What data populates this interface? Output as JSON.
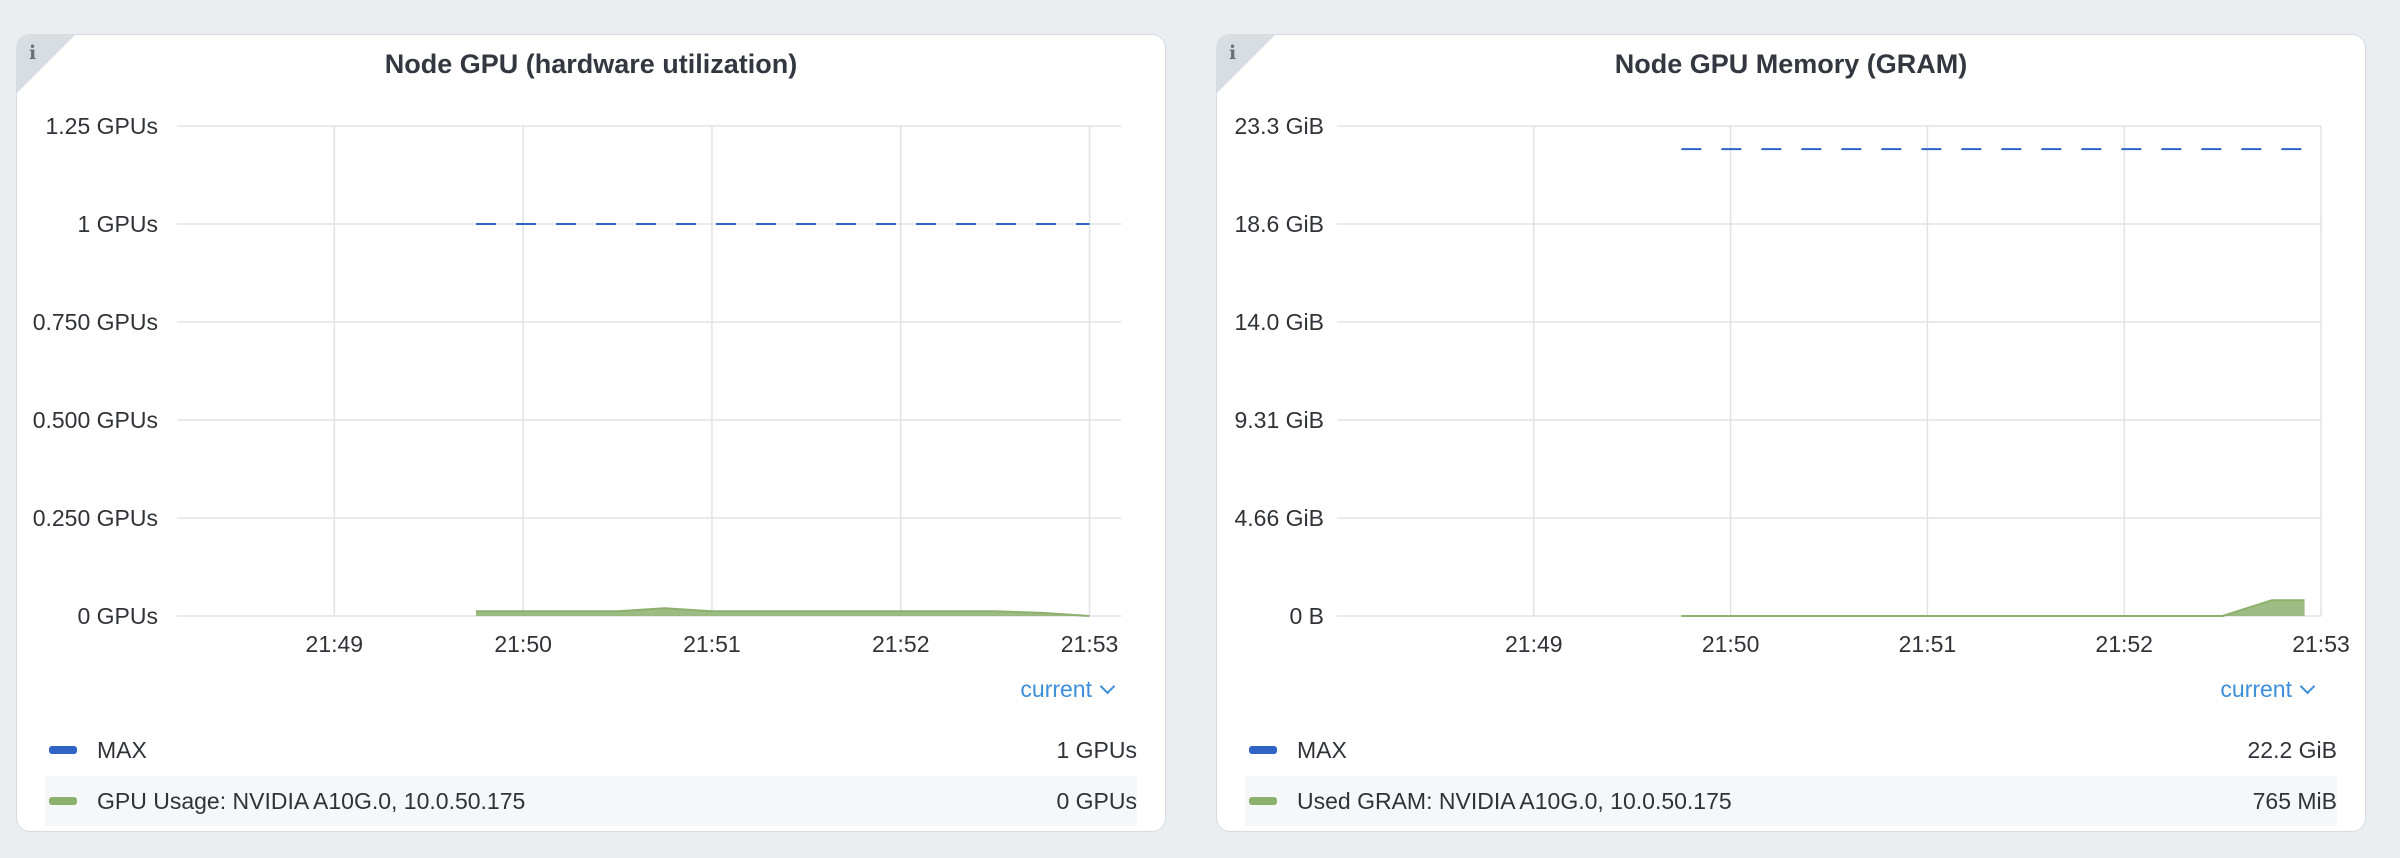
{
  "colors": {
    "max": "#2f63c6",
    "usage": "#8cb06d",
    "grid": "#e0e3e6",
    "link": "#3d8fd9"
  },
  "panels": [
    {
      "title": "Node GPU (hardware utilization)",
      "info_icon": "info-icon",
      "legend_toggle": "current",
      "legend": [
        {
          "name": "MAX",
          "value": "1 GPUs"
        },
        {
          "name": "GPU Usage: NVIDIA A10G.0, 10.0.50.175",
          "value": "0 GPUs"
        }
      ]
    },
    {
      "title": "Node GPU Memory (GRAM)",
      "info_icon": "info-icon",
      "legend_toggle": "current",
      "legend": [
        {
          "name": "MAX",
          "value": "22.2 GiB"
        },
        {
          "name": "Used GRAM: NVIDIA A10G.0, 10.0.50.175",
          "value": "765 MiB"
        }
      ]
    }
  ],
  "chart_data": [
    {
      "type": "area",
      "x_range": [
        "21:48:10",
        "21:53:10"
      ],
      "x_ticks": [
        "21:49",
        "21:50",
        "21:51",
        "21:52",
        "21:53"
      ],
      "y_ticks": [
        "0 GPUs",
        "0.250 GPUs",
        "0.500 GPUs",
        "0.750 GPUs",
        "1 GPUs",
        "1.25 GPUs"
      ],
      "ylim": [
        0,
        1.25
      ],
      "grid": true,
      "legend_position": "bottom",
      "series": [
        {
          "name": "MAX",
          "style": "dashed-line",
          "x": [
            "21:49:45",
            "21:53:00"
          ],
          "y": [
            1,
            1
          ]
        },
        {
          "name": "GPU Usage: NVIDIA A10G.0, 10.0.50.175",
          "style": "area",
          "x": [
            "21:49:45",
            "21:50:00",
            "21:50:30",
            "21:50:45",
            "21:51:00",
            "21:51:30",
            "21:52:00",
            "21:52:30",
            "21:52:45",
            "21:53:00"
          ],
          "y": [
            0.012,
            0.012,
            0.012,
            0.02,
            0.012,
            0.012,
            0.012,
            0.012,
            0.008,
            0
          ]
        }
      ]
    },
    {
      "type": "area",
      "x_range": [
        "21:48:00",
        "21:53:00"
      ],
      "x_ticks": [
        "21:49",
        "21:50",
        "21:51",
        "21:52",
        "21:53"
      ],
      "y_ticks": [
        "0 B",
        "4.66 GiB",
        "9.31 GiB",
        "14.0 GiB",
        "18.6 GiB",
        "23.3 GiB"
      ],
      "ylim": [
        0,
        23.3
      ],
      "grid": true,
      "legend_position": "bottom",
      "series": [
        {
          "name": "MAX",
          "style": "dashed-line",
          "x": [
            "21:49:45",
            "21:52:55"
          ],
          "y": [
            22.2,
            22.2
          ]
        },
        {
          "name": "Used GRAM: NVIDIA A10G.0, 10.0.50.175",
          "style": "area",
          "x": [
            "21:49:45",
            "21:50:00",
            "21:51:00",
            "21:52:00",
            "21:52:30",
            "21:52:45",
            "21:52:55"
          ],
          "y": [
            0.0,
            0.0,
            0.0,
            0.0,
            0.0,
            0.75,
            0.75
          ]
        }
      ]
    }
  ]
}
